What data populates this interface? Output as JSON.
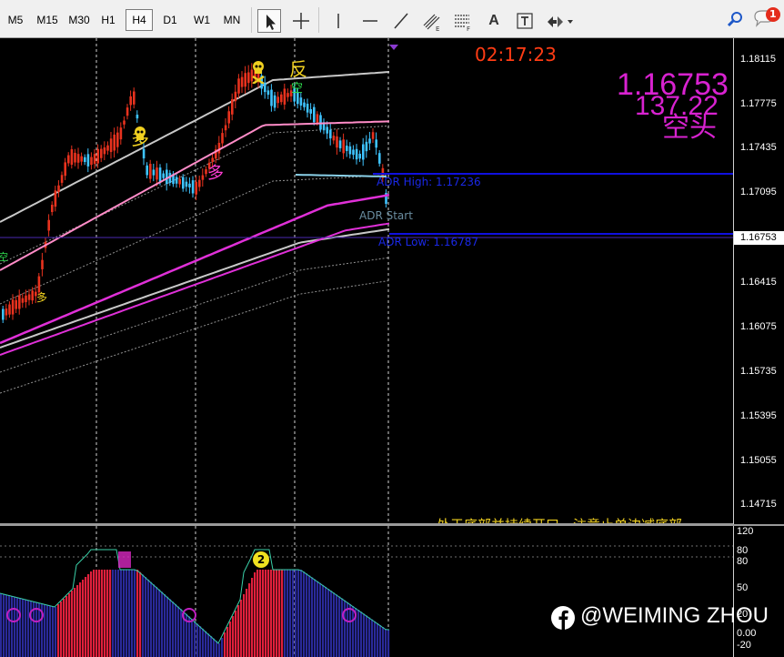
{
  "toolbar": {
    "timeframes": [
      "M5",
      "M15",
      "M30",
      "H1",
      "H4",
      "D1",
      "W1",
      "MN"
    ],
    "active_timeframe": "H4",
    "tools": [
      "cursor-icon",
      "crosshair-icon",
      "vertical-line-icon",
      "horizontal-line-icon",
      "trendline-icon",
      "channel-icon",
      "fibonacci-icon",
      "text-icon",
      "text-label-icon",
      "arrows-icon"
    ],
    "text_tool_label": "A",
    "notification_count": "1"
  },
  "chart": {
    "timer": "02:17:23",
    "big_price": "1.16753",
    "big_value": "137.22",
    "big_status": "空头",
    "adr_high": "ADR High: 1.17236",
    "adr_start": "ADR Start",
    "adr_low": "ADR Low: 1.16787",
    "signal_reverse": "反",
    "signal_short": "空",
    "signal_long": "多",
    "signal_long2": "多",
    "signal_long3": "多",
    "signal_short2": "空",
    "bottom_message": "处于底部并持续开口，注意止单边减底部"
  },
  "price_axis": {
    "labels": [
      "1.18115",
      "1.17775",
      "1.17435",
      "1.17095",
      "1.16753",
      "1.16415",
      "1.16075",
      "1.15735",
      "1.15395",
      "1.15055",
      "1.14715"
    ],
    "current": "1.16753"
  },
  "osc_axis": {
    "labels": [
      "120",
      "80",
      "80",
      "50",
      "20",
      "0.00",
      "-20"
    ]
  },
  "osc": {
    "badge_number": "2"
  },
  "watermark": {
    "handle": "@WEIMING ZHOU"
  },
  "colors": {
    "bull_candle": "#e8321e",
    "bear_candle": "#3ec3ff",
    "ma_pink": "#ff8cc8",
    "ma_magenta": "#e030d8",
    "adr_line": "#1010e0",
    "big_text": "#d822d0",
    "timer": "#ff3c14"
  }
}
